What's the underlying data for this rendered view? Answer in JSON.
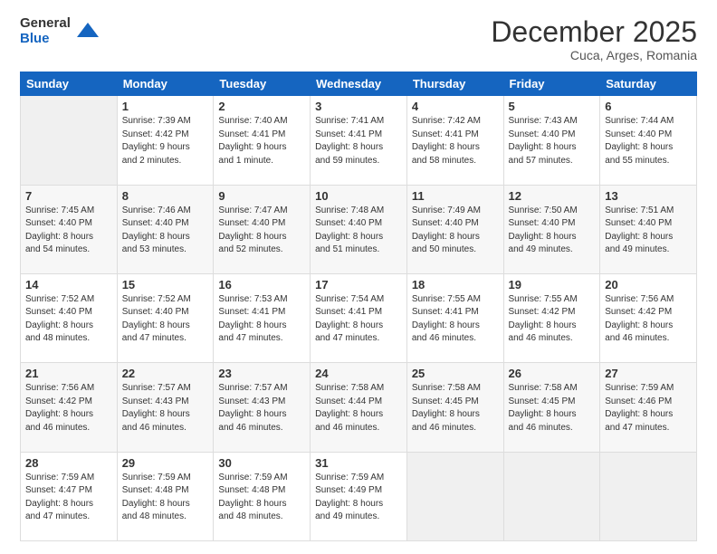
{
  "logo": {
    "general": "General",
    "blue": "Blue"
  },
  "title": "December 2025",
  "subtitle": "Cuca, Arges, Romania",
  "days_header": [
    "Sunday",
    "Monday",
    "Tuesday",
    "Wednesday",
    "Thursday",
    "Friday",
    "Saturday"
  ],
  "weeks": [
    [
      {
        "day": "",
        "info": ""
      },
      {
        "day": "1",
        "info": "Sunrise: 7:39 AM\nSunset: 4:42 PM\nDaylight: 9 hours\nand 2 minutes."
      },
      {
        "day": "2",
        "info": "Sunrise: 7:40 AM\nSunset: 4:41 PM\nDaylight: 9 hours\nand 1 minute."
      },
      {
        "day": "3",
        "info": "Sunrise: 7:41 AM\nSunset: 4:41 PM\nDaylight: 8 hours\nand 59 minutes."
      },
      {
        "day": "4",
        "info": "Sunrise: 7:42 AM\nSunset: 4:41 PM\nDaylight: 8 hours\nand 58 minutes."
      },
      {
        "day": "5",
        "info": "Sunrise: 7:43 AM\nSunset: 4:40 PM\nDaylight: 8 hours\nand 57 minutes."
      },
      {
        "day": "6",
        "info": "Sunrise: 7:44 AM\nSunset: 4:40 PM\nDaylight: 8 hours\nand 55 minutes."
      }
    ],
    [
      {
        "day": "7",
        "info": "Sunrise: 7:45 AM\nSunset: 4:40 PM\nDaylight: 8 hours\nand 54 minutes."
      },
      {
        "day": "8",
        "info": "Sunrise: 7:46 AM\nSunset: 4:40 PM\nDaylight: 8 hours\nand 53 minutes."
      },
      {
        "day": "9",
        "info": "Sunrise: 7:47 AM\nSunset: 4:40 PM\nDaylight: 8 hours\nand 52 minutes."
      },
      {
        "day": "10",
        "info": "Sunrise: 7:48 AM\nSunset: 4:40 PM\nDaylight: 8 hours\nand 51 minutes."
      },
      {
        "day": "11",
        "info": "Sunrise: 7:49 AM\nSunset: 4:40 PM\nDaylight: 8 hours\nand 50 minutes."
      },
      {
        "day": "12",
        "info": "Sunrise: 7:50 AM\nSunset: 4:40 PM\nDaylight: 8 hours\nand 49 minutes."
      },
      {
        "day": "13",
        "info": "Sunrise: 7:51 AM\nSunset: 4:40 PM\nDaylight: 8 hours\nand 49 minutes."
      }
    ],
    [
      {
        "day": "14",
        "info": "Sunrise: 7:52 AM\nSunset: 4:40 PM\nDaylight: 8 hours\nand 48 minutes."
      },
      {
        "day": "15",
        "info": "Sunrise: 7:52 AM\nSunset: 4:40 PM\nDaylight: 8 hours\nand 47 minutes."
      },
      {
        "day": "16",
        "info": "Sunrise: 7:53 AM\nSunset: 4:41 PM\nDaylight: 8 hours\nand 47 minutes."
      },
      {
        "day": "17",
        "info": "Sunrise: 7:54 AM\nSunset: 4:41 PM\nDaylight: 8 hours\nand 47 minutes."
      },
      {
        "day": "18",
        "info": "Sunrise: 7:55 AM\nSunset: 4:41 PM\nDaylight: 8 hours\nand 46 minutes."
      },
      {
        "day": "19",
        "info": "Sunrise: 7:55 AM\nSunset: 4:42 PM\nDaylight: 8 hours\nand 46 minutes."
      },
      {
        "day": "20",
        "info": "Sunrise: 7:56 AM\nSunset: 4:42 PM\nDaylight: 8 hours\nand 46 minutes."
      }
    ],
    [
      {
        "day": "21",
        "info": "Sunrise: 7:56 AM\nSunset: 4:42 PM\nDaylight: 8 hours\nand 46 minutes."
      },
      {
        "day": "22",
        "info": "Sunrise: 7:57 AM\nSunset: 4:43 PM\nDaylight: 8 hours\nand 46 minutes."
      },
      {
        "day": "23",
        "info": "Sunrise: 7:57 AM\nSunset: 4:43 PM\nDaylight: 8 hours\nand 46 minutes."
      },
      {
        "day": "24",
        "info": "Sunrise: 7:58 AM\nSunset: 4:44 PM\nDaylight: 8 hours\nand 46 minutes."
      },
      {
        "day": "25",
        "info": "Sunrise: 7:58 AM\nSunset: 4:45 PM\nDaylight: 8 hours\nand 46 minutes."
      },
      {
        "day": "26",
        "info": "Sunrise: 7:58 AM\nSunset: 4:45 PM\nDaylight: 8 hours\nand 46 minutes."
      },
      {
        "day": "27",
        "info": "Sunrise: 7:59 AM\nSunset: 4:46 PM\nDaylight: 8 hours\nand 47 minutes."
      }
    ],
    [
      {
        "day": "28",
        "info": "Sunrise: 7:59 AM\nSunset: 4:47 PM\nDaylight: 8 hours\nand 47 minutes."
      },
      {
        "day": "29",
        "info": "Sunrise: 7:59 AM\nSunset: 4:48 PM\nDaylight: 8 hours\nand 48 minutes."
      },
      {
        "day": "30",
        "info": "Sunrise: 7:59 AM\nSunset: 4:48 PM\nDaylight: 8 hours\nand 48 minutes."
      },
      {
        "day": "31",
        "info": "Sunrise: 7:59 AM\nSunset: 4:49 PM\nDaylight: 8 hours\nand 49 minutes."
      },
      {
        "day": "",
        "info": ""
      },
      {
        "day": "",
        "info": ""
      },
      {
        "day": "",
        "info": ""
      }
    ]
  ]
}
